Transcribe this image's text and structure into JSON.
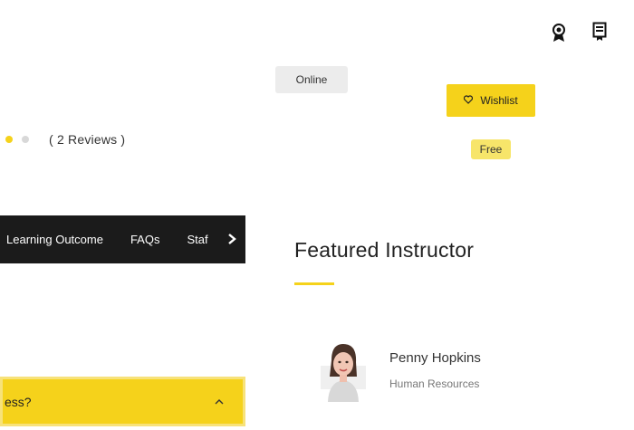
{
  "header": {
    "icons": [
      "award-icon",
      "certificate-icon"
    ]
  },
  "course": {
    "mode_label": "Online",
    "wishlist_label": "Wishlist",
    "price": "Free",
    "rating": {
      "stars_filled": 1,
      "stars_shown": 2,
      "reviews_text": "( 2 Reviews )"
    }
  },
  "tabs": {
    "items": [
      "Learning Outcome",
      "FAQs",
      "Staf"
    ]
  },
  "featured": {
    "title": "Featured Instructor",
    "instructor": {
      "name": "Penny Hopkins",
      "role": "Human Resources"
    }
  },
  "accordion": {
    "question": "ess?"
  },
  "colors": {
    "accent": "#f5d21b",
    "dark": "#1b1b1b"
  }
}
